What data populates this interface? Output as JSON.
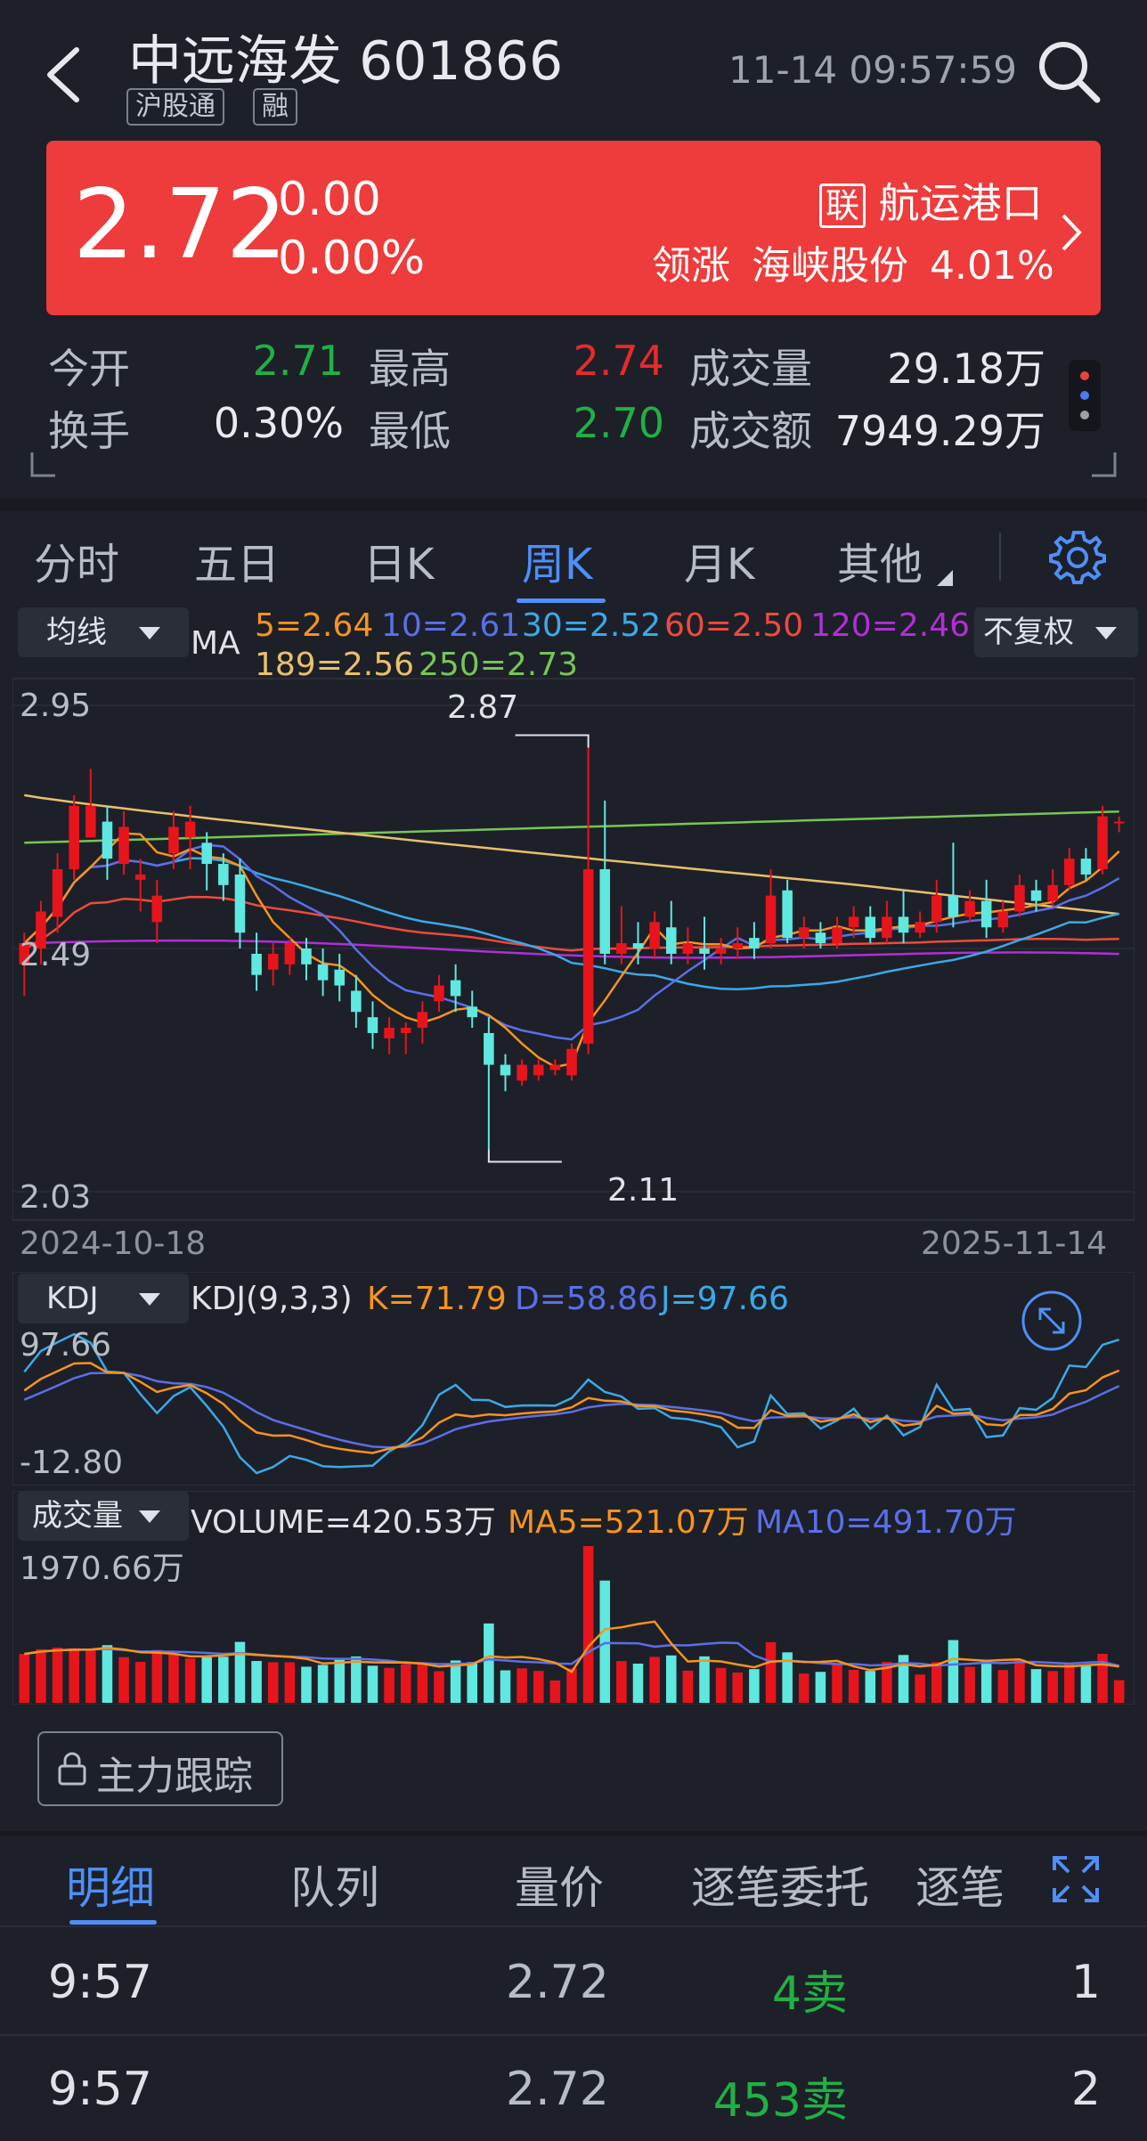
{
  "header": {
    "stock_name": "中远海发",
    "stock_code": "601866",
    "tags": [
      "沪股通",
      "融"
    ],
    "datetime": "11-14 09:57:59"
  },
  "quote": {
    "price": "2.72",
    "change": "0.00",
    "change_pct": "0.00%",
    "sector_badge": "联",
    "sector": "航运港口",
    "lead_label": "领涨",
    "lead_stock": "海峡股份",
    "lead_pct": "4.01%",
    "bg_color": "#ee3b3b"
  },
  "stats": {
    "open_label": "今开",
    "open": "2.71",
    "high_label": "最高",
    "high": "2.74",
    "volume_label": "成交量",
    "volume": "29.18万",
    "turnover_label": "换手",
    "turnover": "0.30%",
    "low_label": "最低",
    "low": "2.70",
    "amount_label": "成交额",
    "amount": "7949.29万"
  },
  "period_tabs": [
    "分时",
    "五日",
    "日K",
    "周K",
    "月K",
    "其他"
  ],
  "active_period": "周K",
  "kline": {
    "indicator_select": "均线",
    "ma_label": "MA",
    "ma_values": [
      {
        "text": "5=2.64",
        "color": "#f7931e"
      },
      {
        "text": "10=2.61",
        "color": "#5a6fe8"
      },
      {
        "text": "30=2.52",
        "color": "#3aa9e8"
      },
      {
        "text": "60=2.50",
        "color": "#ef4a3c"
      },
      {
        "text": "120=2.46",
        "color": "#b22fd6"
      },
      {
        "text": "189=2.56",
        "color": "#e8c06a"
      },
      {
        "text": "250=2.73",
        "color": "#77c654"
      }
    ],
    "adjust_select": "不复权",
    "y_top": "2.95",
    "y_mid": "2.49",
    "y_bottom": "2.03",
    "max_label": "2.87",
    "min_label": "2.11",
    "x_start": "2024-10-18",
    "x_end": "2025-11-14"
  },
  "kdj": {
    "select": "KDJ",
    "params": "KDJ(9,3,3)",
    "k": "K=71.79",
    "d": "D=58.86",
    "j": "J=97.66",
    "y_top": "97.66",
    "y_bottom": "-12.80"
  },
  "volume": {
    "select": "成交量",
    "value": "VOLUME=420.53万",
    "ma5": "MA5=521.07万",
    "ma10": "MA10=491.70万",
    "y_top": "1970.66万"
  },
  "main_force_button": "主力跟踪",
  "detail_tabs": [
    "明细",
    "队列",
    "量价",
    "逐笔委托",
    "逐笔"
  ],
  "active_detail_tab": "明细",
  "trades": [
    {
      "time": "9:57",
      "price": "2.72",
      "volume": "4卖",
      "count": "1"
    },
    {
      "time": "9:57",
      "price": "2.72",
      "volume": "453卖",
      "count": "2"
    }
  ],
  "chart_data": {
    "type": "candlestick",
    "x_start": "2024-10-18",
    "x_end": "2025-11-14",
    "ylim": [
      2.03,
      2.95
    ],
    "candles": [
      [
        2.46,
        2.5,
        2.4,
        2.52
      ],
      [
        2.49,
        2.56,
        2.46,
        2.58
      ],
      [
        2.55,
        2.64,
        2.52,
        2.67
      ],
      [
        2.64,
        2.76,
        2.62,
        2.78
      ],
      [
        2.7,
        2.76,
        2.7,
        2.83
      ],
      [
        2.73,
        2.66,
        2.62,
        2.76
      ],
      [
        2.65,
        2.72,
        2.63,
        2.75
      ],
      [
        2.62,
        2.63,
        2.56,
        2.66
      ],
      [
        2.54,
        2.59,
        2.5,
        2.62
      ],
      [
        2.67,
        2.72,
        2.64,
        2.75
      ],
      [
        2.7,
        2.73,
        2.64,
        2.76
      ],
      [
        2.69,
        2.65,
        2.6,
        2.71
      ],
      [
        2.65,
        2.61,
        2.58,
        2.67
      ],
      [
        2.63,
        2.52,
        2.49,
        2.66
      ],
      [
        2.48,
        2.44,
        2.41,
        2.52
      ],
      [
        2.45,
        2.48,
        2.42,
        2.5
      ],
      [
        2.46,
        2.5,
        2.44,
        2.51
      ],
      [
        2.49,
        2.46,
        2.43,
        2.51
      ],
      [
        2.46,
        2.43,
        2.4,
        2.49
      ],
      [
        2.45,
        2.42,
        2.39,
        2.48
      ],
      [
        2.41,
        2.37,
        2.34,
        2.44
      ],
      [
        2.36,
        2.33,
        2.3,
        2.39
      ],
      [
        2.32,
        2.34,
        2.29,
        2.36
      ],
      [
        2.33,
        2.34,
        2.29,
        2.35
      ],
      [
        2.34,
        2.37,
        2.31,
        2.39
      ],
      [
        2.39,
        2.42,
        2.37,
        2.44
      ],
      [
        2.43,
        2.4,
        2.37,
        2.46
      ],
      [
        2.38,
        2.36,
        2.34,
        2.41
      ],
      [
        2.33,
        2.27,
        2.11,
        2.36
      ],
      [
        2.27,
        2.25,
        2.22,
        2.29
      ],
      [
        2.24,
        2.27,
        2.23,
        2.28
      ],
      [
        2.25,
        2.27,
        2.24,
        2.28
      ],
      [
        2.26,
        2.27,
        2.25,
        2.28
      ],
      [
        2.25,
        2.3,
        2.24,
        2.31
      ],
      [
        2.31,
        2.64,
        2.29,
        2.87
      ],
      [
        2.64,
        2.48,
        2.46,
        2.77
      ],
      [
        2.48,
        2.5,
        2.46,
        2.57
      ],
      [
        2.5,
        2.49,
        2.46,
        2.54
      ],
      [
        2.49,
        2.54,
        2.47,
        2.56
      ],
      [
        2.53,
        2.48,
        2.46,
        2.58
      ],
      [
        2.48,
        2.5,
        2.46,
        2.53
      ],
      [
        2.49,
        2.48,
        2.45,
        2.55
      ],
      [
        2.48,
        2.49,
        2.46,
        2.51
      ],
      [
        2.49,
        2.5,
        2.47,
        2.53
      ],
      [
        2.51,
        2.49,
        2.47,
        2.54
      ],
      [
        2.5,
        2.59,
        2.49,
        2.64
      ],
      [
        2.6,
        2.51,
        2.5,
        2.62
      ],
      [
        2.51,
        2.53,
        2.49,
        2.55
      ],
      [
        2.52,
        2.5,
        2.49,
        2.54
      ],
      [
        2.5,
        2.53,
        2.49,
        2.55
      ],
      [
        2.53,
        2.55,
        2.51,
        2.57
      ],
      [
        2.55,
        2.51,
        2.5,
        2.57
      ],
      [
        2.51,
        2.55,
        2.5,
        2.58
      ],
      [
        2.55,
        2.52,
        2.5,
        2.6
      ],
      [
        2.52,
        2.54,
        2.51,
        2.56
      ],
      [
        2.54,
        2.59,
        2.52,
        2.62
      ],
      [
        2.59,
        2.55,
        2.53,
        2.69
      ],
      [
        2.55,
        2.58,
        2.54,
        2.6
      ],
      [
        2.58,
        2.53,
        2.51,
        2.62
      ],
      [
        2.53,
        2.56,
        2.52,
        2.58
      ],
      [
        2.56,
        2.61,
        2.55,
        2.63
      ],
      [
        2.6,
        2.58,
        2.56,
        2.62
      ],
      [
        2.58,
        2.61,
        2.57,
        2.64
      ],
      [
        2.61,
        2.66,
        2.6,
        2.68
      ],
      [
        2.66,
        2.63,
        2.62,
        2.68
      ],
      [
        2.64,
        2.74,
        2.63,
        2.76
      ],
      [
        2.73,
        2.73,
        2.71,
        2.74
      ]
    ],
    "ma_lines": [
      "MA5",
      "MA10",
      "MA30",
      "MA60",
      "MA120",
      "MA189",
      "MA250"
    ]
  }
}
